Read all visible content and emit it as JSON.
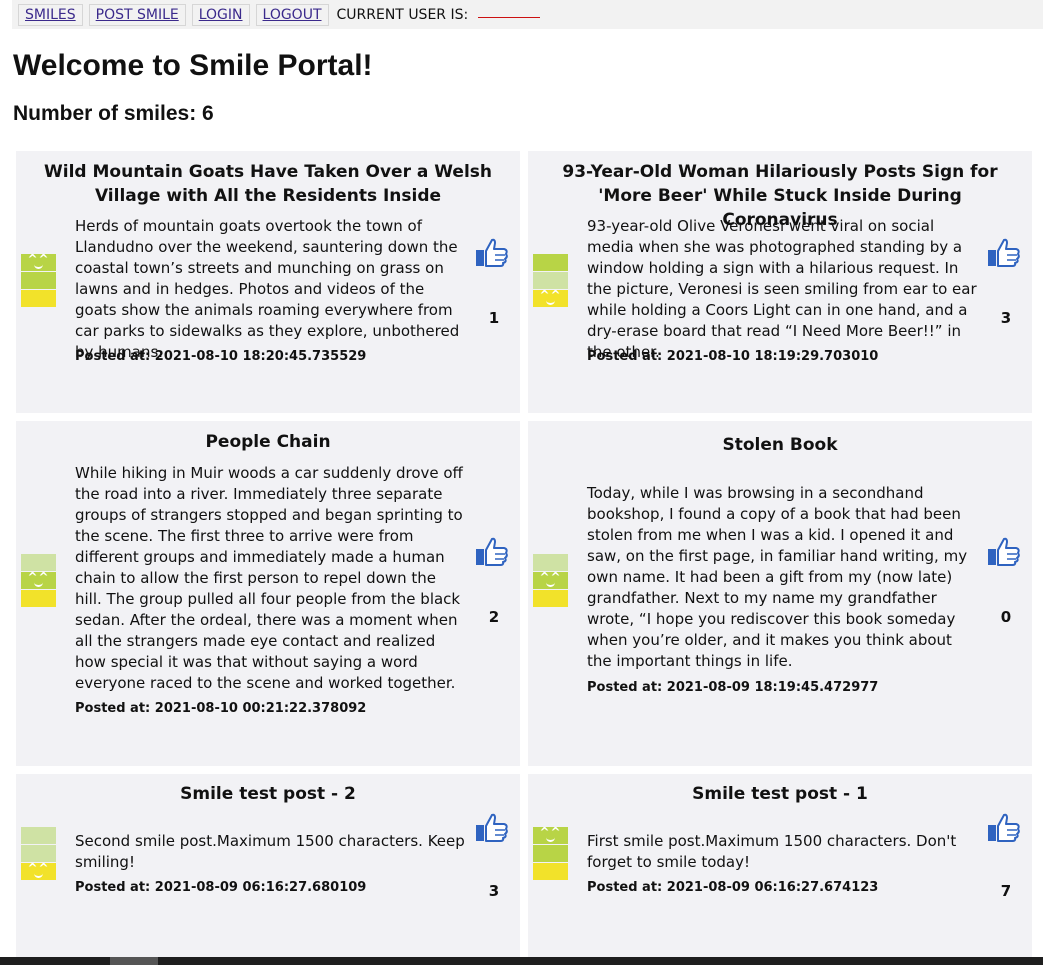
{
  "nav": {
    "links": [
      "SMILES",
      "POST SMILE",
      "LOGIN",
      "LOGOUT"
    ],
    "current_user_label": "CURRENT USER IS:",
    "current_user_value": ""
  },
  "page": {
    "title": "Welcome to Smile Portal!",
    "count_text": "Number of smiles: 6"
  },
  "colors": {
    "meter_light": "#cfe2a4",
    "meter_mid": "#b8d446",
    "meter_high": "#f2e22a",
    "like_icon": "#2f63c0"
  },
  "posts": [
    {
      "title": "Wild Mountain Goats Have Taken Over a Welsh Village with All the Residents Inside",
      "body": "Herds of mountain goats overtook the town of Llandudno over the weekend, sauntering down the coastal town’s streets and munching on grass on lawns and in hedges. Photos and videos of the goats show the animals roaming everywhere from car parks to sidewalks as they explore, unbothered by humans.",
      "posted": "Posted at: 2021-08-10 18:20:45.735529",
      "likes": "1",
      "smile_level": 3
    },
    {
      "title": "93-Year-Old Woman Hilariously Posts Sign for 'More Beer' While Stuck Inside During Coronavirus",
      "body": "93-year-old Olive Veronesi went viral on social media when she was photographed standing by a window holding a sign with a hilarious request. In the picture, Veronesi is seen smiling from ear to ear while holding a Coors Light can in one hand, and a dry-erase board that read “I Need More Beer!!” in the other.",
      "posted": "Posted at: 2021-08-10 18:19:29.703010",
      "likes": "3",
      "smile_level": 1
    },
    {
      "title": "People Chain",
      "body": "While hiking in Muir woods a car suddenly drove off the road into a river. Immediately three separate groups of strangers stopped and began sprinting to the scene. The first three to arrive were from different groups and immediately made a human chain to allow the first person to repel down the hill. The group pulled all four people from the black sedan. After the ordeal, there was a moment when all the strangers made eye contact and realized how special it was that without saying a word everyone raced to the scene and worked together.",
      "posted": "Posted at: 2021-08-10 00:21:22.378092",
      "likes": "2",
      "smile_level": 2
    },
    {
      "title": "Stolen Book",
      "body": "Today, while I was browsing in a secondhand bookshop, I found a copy of a book that had been stolen from me when I was a kid. I opened it and saw, on the first page, in familiar hand writing, my own name. It had been a gift from my (now late) grandfather. Next to my name my grandfather wrote, “I hope you rediscover this book someday when you’re older, and it makes you think about the important things in life.",
      "posted": "Posted at: 2021-08-09 18:19:45.472977",
      "likes": "0",
      "smile_level": 2
    },
    {
      "title": "Smile test post - 2",
      "body": "Second smile post.Maximum 1500 characters. Keep smiling!",
      "posted": "Posted at: 2021-08-09 06:16:27.680109",
      "likes": "3",
      "smile_level": 1
    },
    {
      "title": "Smile test post - 1",
      "body": "First smile post.Maximum 1500 characters. Don't forget to smile today!",
      "posted": "Posted at: 2021-08-09 06:16:27.674123",
      "likes": "7",
      "smile_level": 3
    }
  ]
}
